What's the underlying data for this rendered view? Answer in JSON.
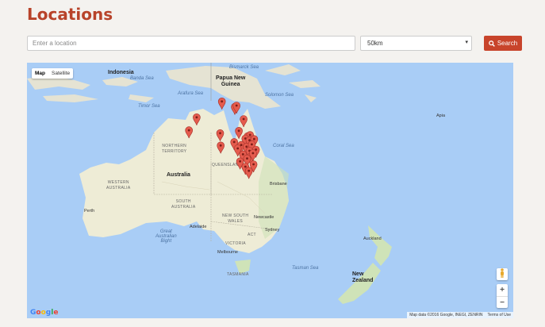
{
  "page": {
    "title": "Locations"
  },
  "search": {
    "placeholder": "Enter a location",
    "radius_value": "50km",
    "button_label": "Search"
  },
  "map": {
    "type_controls": {
      "map": "Map",
      "satellite": "Satellite"
    },
    "labels": {
      "indonesia": "Indonesia",
      "papua_new_guinea": "Papua New\nGuinea",
      "banda_sea": "Banda Sea",
      "bismarck_sea": "Bismarck Sea",
      "arafura_sea": "Arafura Sea",
      "solomon_sea": "Solomon Sea",
      "timor_sea": "Timor Sea",
      "coral_sea": "Coral Sea",
      "tasman_sea": "Tasman Sea",
      "great_australian_bight": "Great\nAustralian\nBight",
      "australia": "Australia",
      "northern_territory": "NORTHERN\nTERRITORY",
      "queensland": "QUEENSLAND",
      "western_australia": "WESTERN\nAUSTRALIA",
      "south_australia": "SOUTH\nAUSTRALIA",
      "new_south_wales": "NEW SOUTH\nWALES",
      "victoria": "VICTORIA",
      "tasmania": "TASMANIA",
      "act": "ACT",
      "perth": "Perth",
      "adelaide": "Adelaide",
      "melbourne": "Melbourne",
      "sydney": "Sydney",
      "newcastle": "Newcastle",
      "brisbane": "Brisbane",
      "auckland": "Auckland",
      "new_zealand": "New\nZealand",
      "apia": "Apia"
    },
    "zoom_in": "+",
    "zoom_out": "−",
    "attribution": "Map data ©2016 Google, INEGI, ZENRIN",
    "terms": "Terms of Use",
    "logo": "Google",
    "markers": [
      {
        "lat": -14.6,
        "lng": 145.2
      },
      {
        "lat": -17.3,
        "lng": 140.9
      },
      {
        "lat": -15.5,
        "lng": 147.4
      },
      {
        "lat": -15.3,
        "lng": 147.7
      },
      {
        "lat": -17.6,
        "lng": 148.9
      },
      {
        "lat": -19.5,
        "lng": 139.6
      },
      {
        "lat": -20.0,
        "lng": 144.9
      },
      {
        "lat": -19.6,
        "lng": 148.1
      },
      {
        "lat": -20.5,
        "lng": 149.6
      },
      {
        "lat": -20.3,
        "lng": 150.0
      },
      {
        "lat": -20.9,
        "lng": 149.2
      },
      {
        "lat": -21.2,
        "lng": 149.9
      },
      {
        "lat": -21.0,
        "lng": 150.7
      },
      {
        "lat": -21.5,
        "lng": 147.3
      },
      {
        "lat": -22.0,
        "lng": 148.5
      },
      {
        "lat": -22.3,
        "lng": 149.4
      },
      {
        "lat": -21.9,
        "lng": 150.3
      },
      {
        "lat": -22.8,
        "lng": 151.0
      },
      {
        "lat": -22.1,
        "lng": 145.0
      },
      {
        "lat": -22.6,
        "lng": 147.9
      },
      {
        "lat": -23.0,
        "lng": 149.9
      },
      {
        "lat": -23.6,
        "lng": 148.8
      },
      {
        "lat": -24.0,
        "lng": 150.1
      },
      {
        "lat": -24.3,
        "lng": 149.5
      },
      {
        "lat": -23.4,
        "lng": 150.5
      },
      {
        "lat": -24.8,
        "lng": 148.3
      },
      {
        "lat": -25.7,
        "lng": 149.2
      },
      {
        "lat": -25.3,
        "lng": 150.6
      },
      {
        "lat": -26.4,
        "lng": 149.8
      }
    ]
  }
}
